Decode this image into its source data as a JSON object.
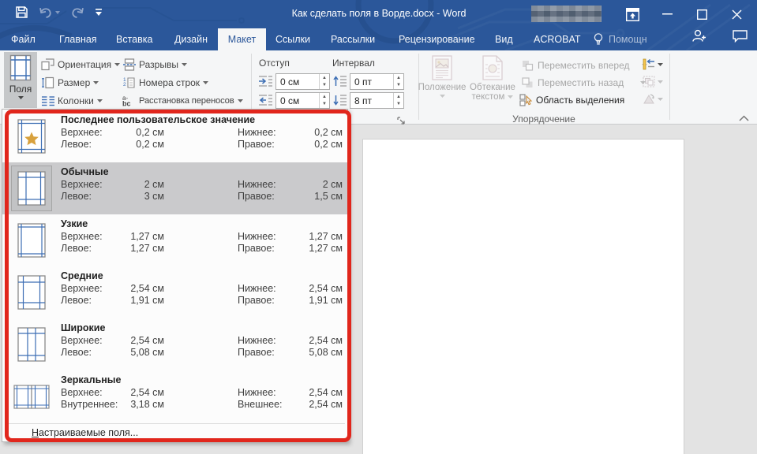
{
  "titlebar": {
    "title": "Как сделать поля в Ворде.docx - Word",
    "qat": [
      "save-icon",
      "undo-icon",
      "redo-icon",
      "customize-qat-icon"
    ]
  },
  "tabs": {
    "active": "Макет",
    "items": [
      {
        "label": "Файл"
      },
      {
        "label": "Главная"
      },
      {
        "label": "Вставка"
      },
      {
        "label": "Дизайн"
      },
      {
        "label": "Макет"
      },
      {
        "label": "Ссылки"
      },
      {
        "label": "Рассылки"
      },
      {
        "label": "Рецензирование"
      },
      {
        "label": "Вид"
      },
      {
        "label": "ACROBAT"
      },
      {
        "label": "Помощн"
      }
    ]
  },
  "ribbon": {
    "page_setup": {
      "margins": "Поля",
      "orientation": "Ориентация",
      "size": "Размер",
      "columns": "Колонки",
      "breaks": "Разрывы",
      "line_numbers": "Номера строк",
      "hyphenation": "Расстановка переносов"
    },
    "paragraph": {
      "indent_label": "Отступ",
      "spacing_label": "Интервал",
      "indent_left_value": "0 см",
      "indent_right_value": "0 см",
      "spacing_before_value": "0 пт",
      "spacing_after_value": "8 пт"
    },
    "arrange": {
      "position": "Положение",
      "wrap_line1": "Обтекание",
      "wrap_line2": "текстом",
      "bring_forward": "Переместить вперед",
      "send_backward": "Переместить назад",
      "selection_pane": "Область выделения",
      "group_label": "Упорядочение"
    }
  },
  "menu": {
    "items": [
      {
        "title": "Последнее пользовательское значение",
        "l1": "Верхнее:",
        "v1": "0,2 см",
        "l2": "Нижнее:",
        "v2": "0,2 см",
        "l3": "Левое:",
        "v3": "0,2 см",
        "l4": "Правое:",
        "v4": "0,2 см"
      },
      {
        "title": "Обычные",
        "l1": "Верхнее:",
        "v1": "2 см",
        "l2": "Нижнее:",
        "v2": "2 см",
        "l3": "Левое:",
        "v3": "3 см",
        "l4": "Правое:",
        "v4": "1,5 см"
      },
      {
        "title": "Узкие",
        "l1": "Верхнее:",
        "v1": "1,27 см",
        "l2": "Нижнее:",
        "v2": "1,27 см",
        "l3": "Левое:",
        "v3": "1,27 см",
        "l4": "Правое:",
        "v4": "1,27 см"
      },
      {
        "title": "Средние",
        "l1": "Верхнее:",
        "v1": "2,54 см",
        "l2": "Нижнее:",
        "v2": "2,54 см",
        "l3": "Левое:",
        "v3": "1,91 см",
        "l4": "Правое:",
        "v4": "1,91 см"
      },
      {
        "title": "Широкие",
        "l1": "Верхнее:",
        "v1": "2,54 см",
        "l2": "Нижнее:",
        "v2": "2,54 см",
        "l3": "Левое:",
        "v3": "5,08 см",
        "l4": "Правое:",
        "v4": "5,08 см"
      },
      {
        "title": "Зеркальные",
        "l1": "Верхнее:",
        "v1": "2,54 см",
        "l2": "Нижнее:",
        "v2": "2,54 см",
        "l3": "Внутреннее:",
        "v3": "3,18 см",
        "l4": "Внешнее:",
        "v4": "2,54 см"
      }
    ],
    "custom_accel": "Н",
    "custom_rest": "астраиваемые поля..."
  },
  "colors": {
    "header_blue": "#2B579A",
    "ribbon_bg": "#F5F6F7",
    "selected_item_bg": "#CACACC",
    "annotation_red": "#E1261C",
    "icon_blue": "#3C6EB4",
    "star_gold": "#D8A13D"
  }
}
